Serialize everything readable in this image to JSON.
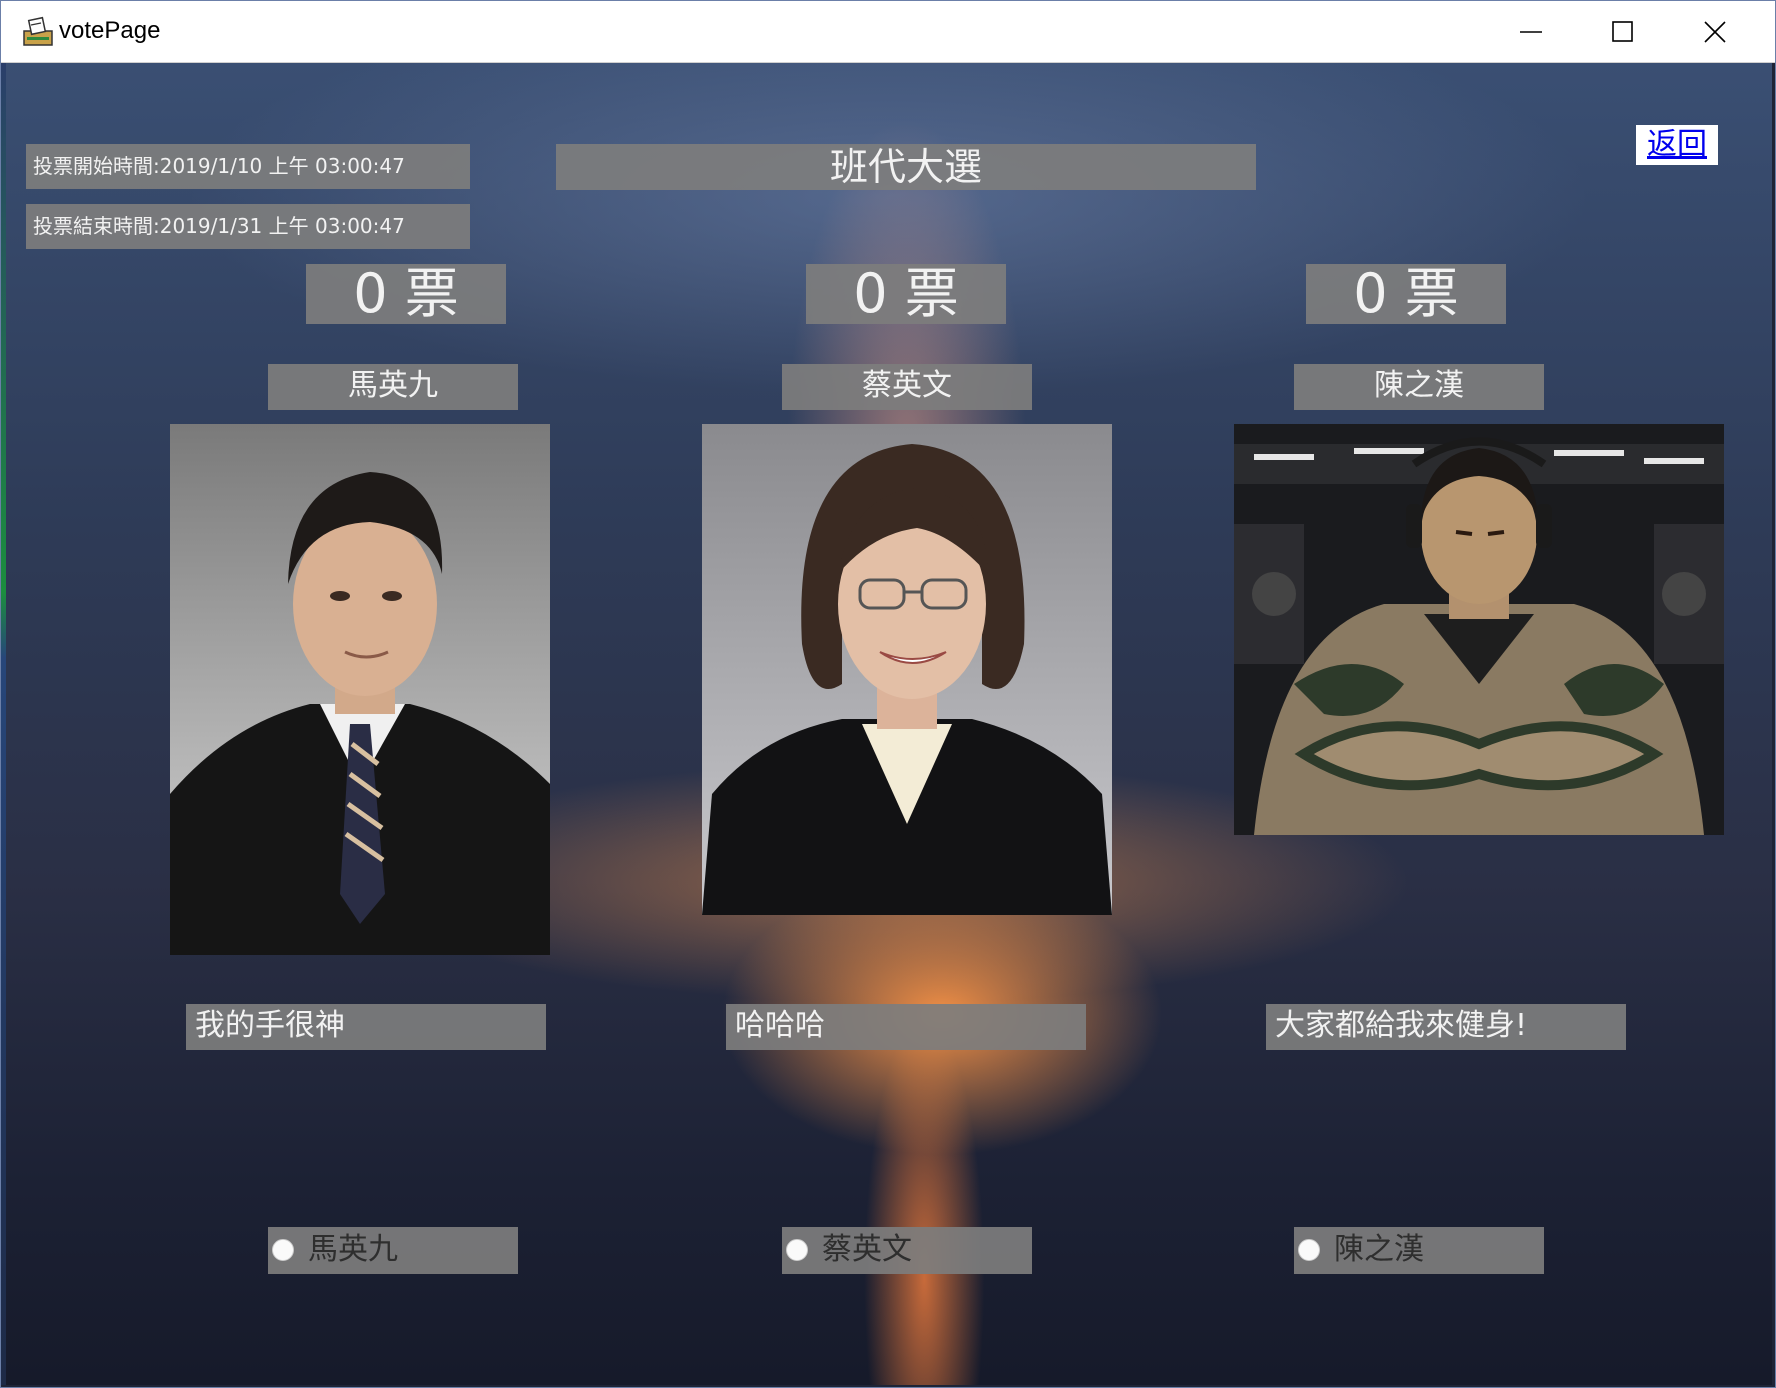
{
  "window": {
    "title": "votePage"
  },
  "header": {
    "vote_start": "投票開始時間:2019/1/10 上午 03:00:47",
    "vote_end": "投票結束時間:2019/1/31 上午 03:00:47",
    "election_title": "班代大選",
    "back_link": "返回"
  },
  "candidates": [
    {
      "votes": "0 票",
      "name": "馬英九",
      "slogan": "我的手很神",
      "radio_label": "馬英九",
      "selected": false
    },
    {
      "votes": "0 票",
      "name": "蔡英文",
      "slogan": "哈哈哈",
      "radio_label": "蔡英文",
      "selected": false
    },
    {
      "votes": "0 票",
      "name": "陳之漢",
      "slogan": "大家都給我來健身!",
      "radio_label": "陳之漢",
      "selected": false
    }
  ],
  "colors": {
    "panel_gray": "#7d7d7d",
    "link_blue": "#0000ee",
    "sunset_orange": "#ff9646"
  }
}
